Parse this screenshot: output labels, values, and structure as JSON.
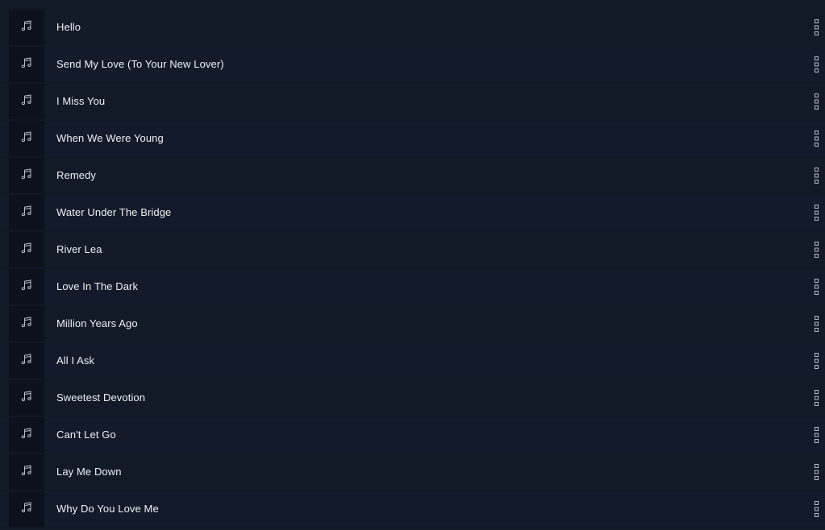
{
  "colors": {
    "background": "#111826",
    "row": "#121a28",
    "thumb": "#0c111b",
    "text": "#eef1f6",
    "icon": "#b8bec8"
  },
  "icons": {
    "thumbnail": "music-note-icon",
    "menu": "more-vertical-icon"
  },
  "tracks": [
    {
      "title": "Hello"
    },
    {
      "title": "Send My Love (To Your New Lover)"
    },
    {
      "title": "I Miss You"
    },
    {
      "title": "When We Were Young"
    },
    {
      "title": "Remedy"
    },
    {
      "title": "Water Under The Bridge"
    },
    {
      "title": "River Lea"
    },
    {
      "title": "Love In The Dark"
    },
    {
      "title": "Million Years Ago"
    },
    {
      "title": "All I Ask"
    },
    {
      "title": "Sweetest Devotion"
    },
    {
      "title": "Can't Let Go"
    },
    {
      "title": "Lay Me Down"
    },
    {
      "title": "Why Do You Love Me"
    }
  ]
}
